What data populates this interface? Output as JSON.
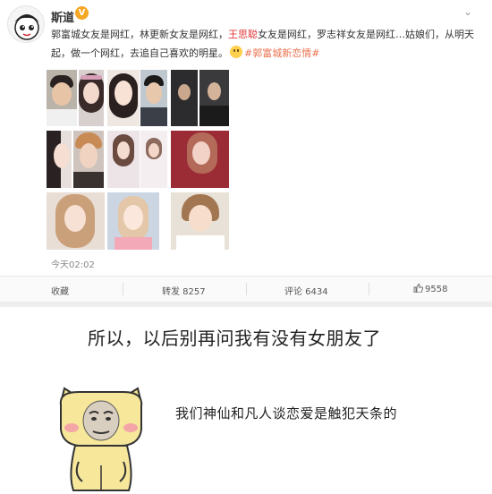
{
  "post": {
    "username": "斯道",
    "verified_badge": "V",
    "text_prefix": "郭富城女友是网红，林更新女友是网红，",
    "text_highlight": "王思聪",
    "text_suffix": "女友是网红，罗志祥女友是网红…姑娘们，从明天起，做一个网红，去追自己喜欢的明星。",
    "hashtag": "#郭富城新恋情#",
    "timestamp": "今天02:02",
    "menu_icon": "chevron-down-icon"
  },
  "photos": {
    "count": 14
  },
  "actions": {
    "favorite": "收藏",
    "repost": "转发 8257",
    "comment": "评论 6434",
    "like": "9558"
  },
  "meme": {
    "caption_top": "所以，以后别再问我有没有女朋友了",
    "caption_side": "我们神仙和凡人谈恋爱是触犯天条的"
  },
  "colors": {
    "highlight": "#e4393c",
    "hashtag": "#eb7350",
    "badge": "#f5a623"
  }
}
